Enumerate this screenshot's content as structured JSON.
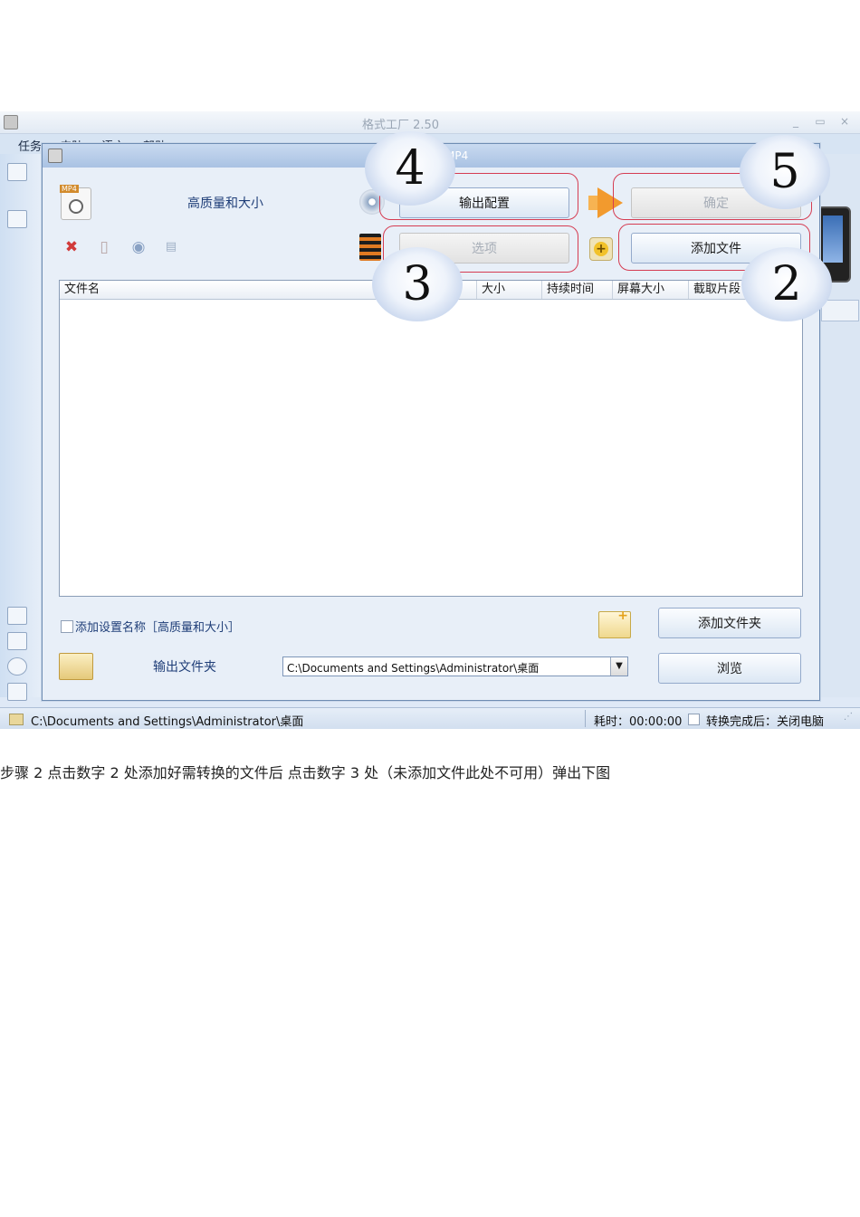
{
  "app": {
    "title": "格式工厂 2.50",
    "menu": [
      "任务",
      "皮肤",
      "语言",
      "帮助"
    ],
    "window_controls": [
      "_",
      "▭",
      "×"
    ]
  },
  "dialog": {
    "title": "MP4",
    "profile_label": "高质量和大小",
    "buttons": {
      "output_config": "输出配置",
      "ok": "确定",
      "options": "选项",
      "add_file": "添加文件",
      "add_folder": "添加文件夹",
      "browse": "浏览"
    },
    "list_columns": [
      "文件名",
      "大小",
      "持续时间",
      "屏幕大小",
      "截取片段"
    ],
    "add_setting_name_label": "添加设置名称［高质量和大小］",
    "output_folder_label": "输出文件夹",
    "output_folder_path": "C:\\Documents and Settings\\Administrator\\桌面"
  },
  "annotations": {
    "cloud_4": "4",
    "cloud_5": "5",
    "cloud_3": "3",
    "cloud_2": "2"
  },
  "statusbar": {
    "path": "C:\\Documents and Settings\\Administrator\\桌面",
    "elapsed": "耗时：00:00:00",
    "after_done": "转换完成后：关闭电脑"
  },
  "caption": "步骤 2  点击数字 2 处添加好需转换的文件后  点击数字 3 处（未添加文件此处不可用）弹出下图",
  "colors": {
    "highlight_outline": "#d53c52",
    "title_accent": "#1f3e78"
  }
}
